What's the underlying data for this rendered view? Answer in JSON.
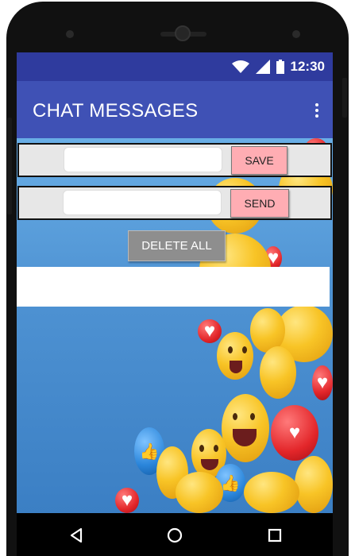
{
  "status_bar": {
    "time": "12:30",
    "icons": [
      "wifi-icon",
      "signal-icon",
      "battery-icon"
    ],
    "color": "#2f3b9e"
  },
  "app_bar": {
    "title": "CHAT MESSAGES",
    "menu_icon": "overflow-menu-icon",
    "color": "#3f51b5"
  },
  "message_row": {
    "value": "",
    "placeholder": "",
    "save_label": "SAVE"
  },
  "send_row": {
    "value": "",
    "placeholder": "",
    "send_label": "SEND"
  },
  "delete_all_label": "DELETE ALL",
  "colors": {
    "button_pink": "#ffadb3",
    "delete_gray": "#8e8e8e",
    "background_blue": "#4f93d3"
  },
  "nav_bar": {
    "items": [
      "back-icon",
      "home-icon",
      "recents-icon"
    ]
  }
}
